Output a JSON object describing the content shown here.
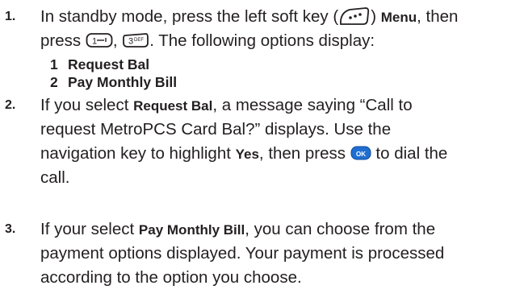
{
  "steps": [
    {
      "number": "1.",
      "line1": {
        "a": "In standby mode, press the left soft key (",
        "b": ") ",
        "bold": "Menu",
        "c": ", then"
      },
      "line2": {
        "a": "press ",
        "b": ", ",
        "c": ". The following options display:"
      },
      "options": [
        {
          "num": "1",
          "label": "Request Bal"
        },
        {
          "num": "2",
          "label": "Pay Monthly Bill"
        }
      ]
    },
    {
      "number": "2.",
      "line1": {
        "a": "If you select ",
        "bold": "Request Bal",
        "b": ", a message saying “Call to"
      },
      "line2": "request MetroPCS Card Bal?” displays. Use the",
      "line3": {
        "a": "navigation key to highlight ",
        "bold": "Yes",
        "b": ", then press ",
        "c": " to dial the"
      },
      "line4": "call."
    },
    {
      "number": "3.",
      "line1": {
        "a": "If your select ",
        "bold": "Pay Monthly Bill",
        "b": ", you can choose from the"
      },
      "line2": "payment options displayed. Your payment is processed",
      "line3": "according to the option you choose."
    }
  ],
  "keys": {
    "soft_key": "•••",
    "key_1": "1—’",
    "key_3": "3ᴰᴱᶠ",
    "ok_key": "OK"
  },
  "colors": {
    "text": "#231f20",
    "ok_key": "#1f6fd1"
  }
}
